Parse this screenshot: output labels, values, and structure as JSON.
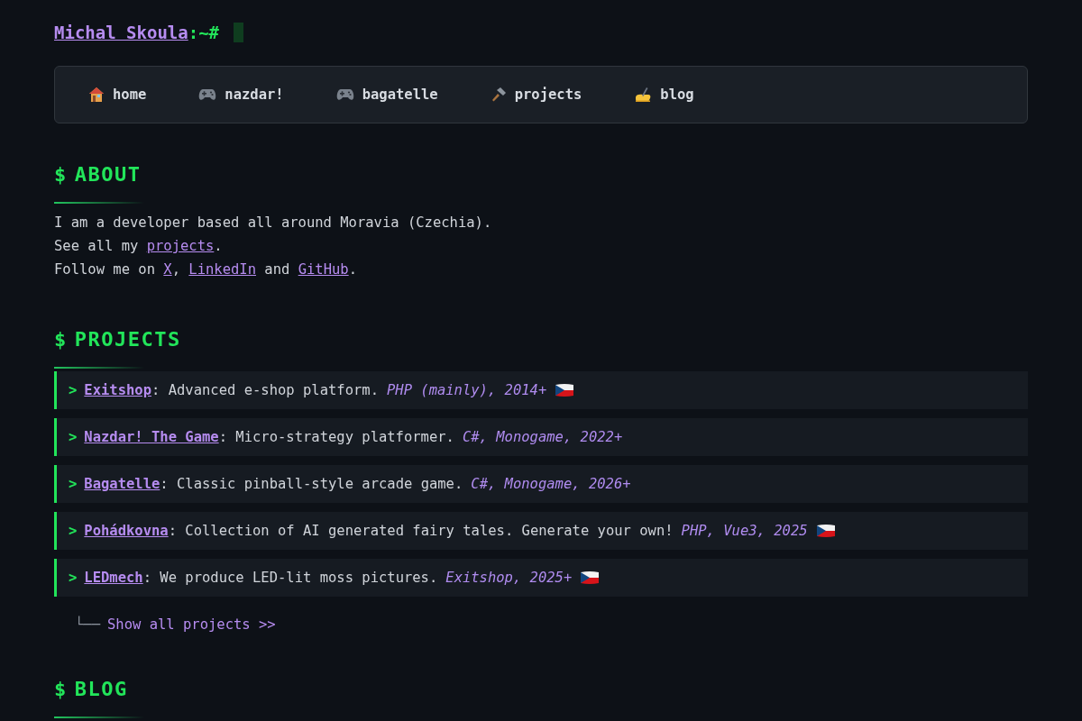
{
  "header": {
    "name": "Michal Skoula",
    "prompt": ":~#"
  },
  "nav": [
    {
      "kind": "house",
      "label": "home"
    },
    {
      "kind": "gamepad",
      "label": "nazdar!"
    },
    {
      "kind": "gamepad",
      "label": "bagatelle"
    },
    {
      "kind": "hammer",
      "label": "projects"
    },
    {
      "kind": "writing",
      "label": "blog"
    }
  ],
  "about": {
    "prefix": "$",
    "title": "ABOUT",
    "lines": [
      [
        {
          "kind": "text",
          "text": "I am a developer based all around Moravia (Czechia)."
        }
      ],
      [
        {
          "kind": "text",
          "text": "See all my "
        },
        {
          "kind": "link",
          "text": "projects"
        },
        {
          "kind": "text",
          "text": "."
        }
      ],
      [
        {
          "kind": "text",
          "text": "Follow me on "
        },
        {
          "kind": "link",
          "text": "X"
        },
        {
          "kind": "text",
          "text": ", "
        },
        {
          "kind": "link",
          "text": "LinkedIn"
        },
        {
          "kind": "text",
          "text": " and "
        },
        {
          "kind": "link",
          "text": "GitHub"
        },
        {
          "kind": "text",
          "text": "."
        }
      ]
    ]
  },
  "projects": {
    "prefix": "$",
    "title": "PROJECTS",
    "marker": ">",
    "items": [
      {
        "name": "Exitshop",
        "description": ": Advanced e-shop platform.",
        "meta": "PHP (mainly), 2014+",
        "flag": true
      },
      {
        "name": "Nazdar! The Game",
        "description": ": Micro-strategy platformer.",
        "meta": "C#, Monogame, 2022+",
        "flag": false
      },
      {
        "name": "Bagatelle",
        "description": ": Classic pinball-style arcade game.",
        "meta": "C#, Monogame, 2026+",
        "flag": false
      },
      {
        "name": "Pohádkovna",
        "description": ": Collection of AI generated fairy tales. Generate your own!",
        "meta": "PHP, Vue3, 2025",
        "flag": true
      },
      {
        "name": "LEDmech",
        "description": ": We produce LED-lit moss pictures.",
        "meta": "Exitshop, 2025+",
        "flag": true
      }
    ],
    "tree": "└──",
    "show_all": "Show all projects >>"
  },
  "blog": {
    "prefix": "$",
    "title": "BLOG"
  }
}
